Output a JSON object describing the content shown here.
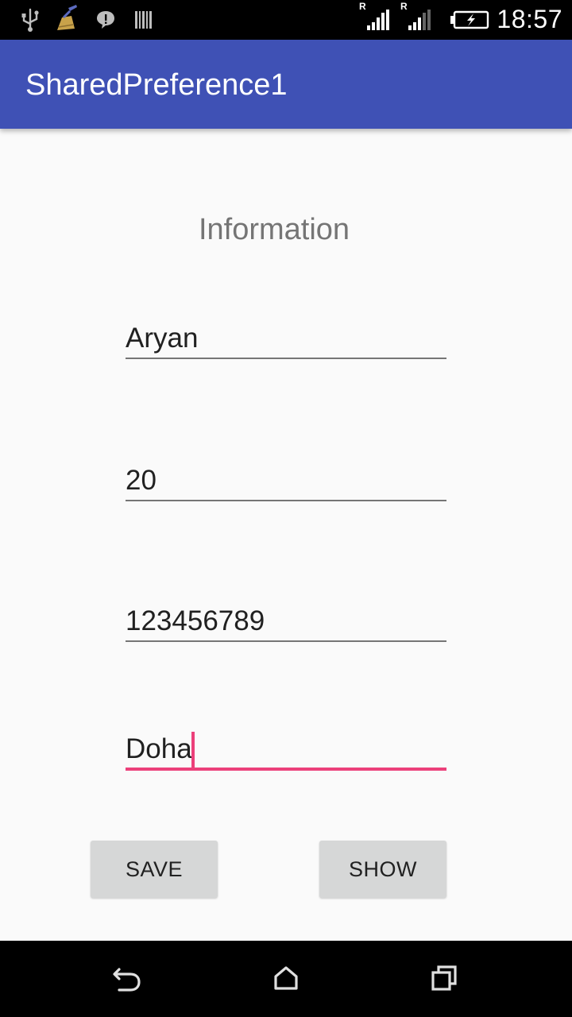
{
  "status_bar": {
    "time": "18:57",
    "icons": [
      "usb-icon",
      "cleaner-icon",
      "chat-bubble-icon",
      "barcode-icon",
      "signal-roaming-icon",
      "signal-roaming-icon",
      "battery-charging-icon"
    ],
    "roaming_indicator": "R"
  },
  "app_bar": {
    "title": "SharedPreference1",
    "color": "#3f51b5"
  },
  "form": {
    "heading": "Information",
    "fields": [
      {
        "value": "Aryan"
      },
      {
        "value": "20"
      },
      {
        "value": "123456789"
      },
      {
        "value": "Doha",
        "focused": true
      }
    ],
    "accent_color": "#ec407a"
  },
  "buttons": {
    "save_label": "SAVE",
    "show_label": "SHOW"
  },
  "nav_bar": {
    "icons": [
      "back-icon",
      "home-icon",
      "recents-icon"
    ]
  }
}
